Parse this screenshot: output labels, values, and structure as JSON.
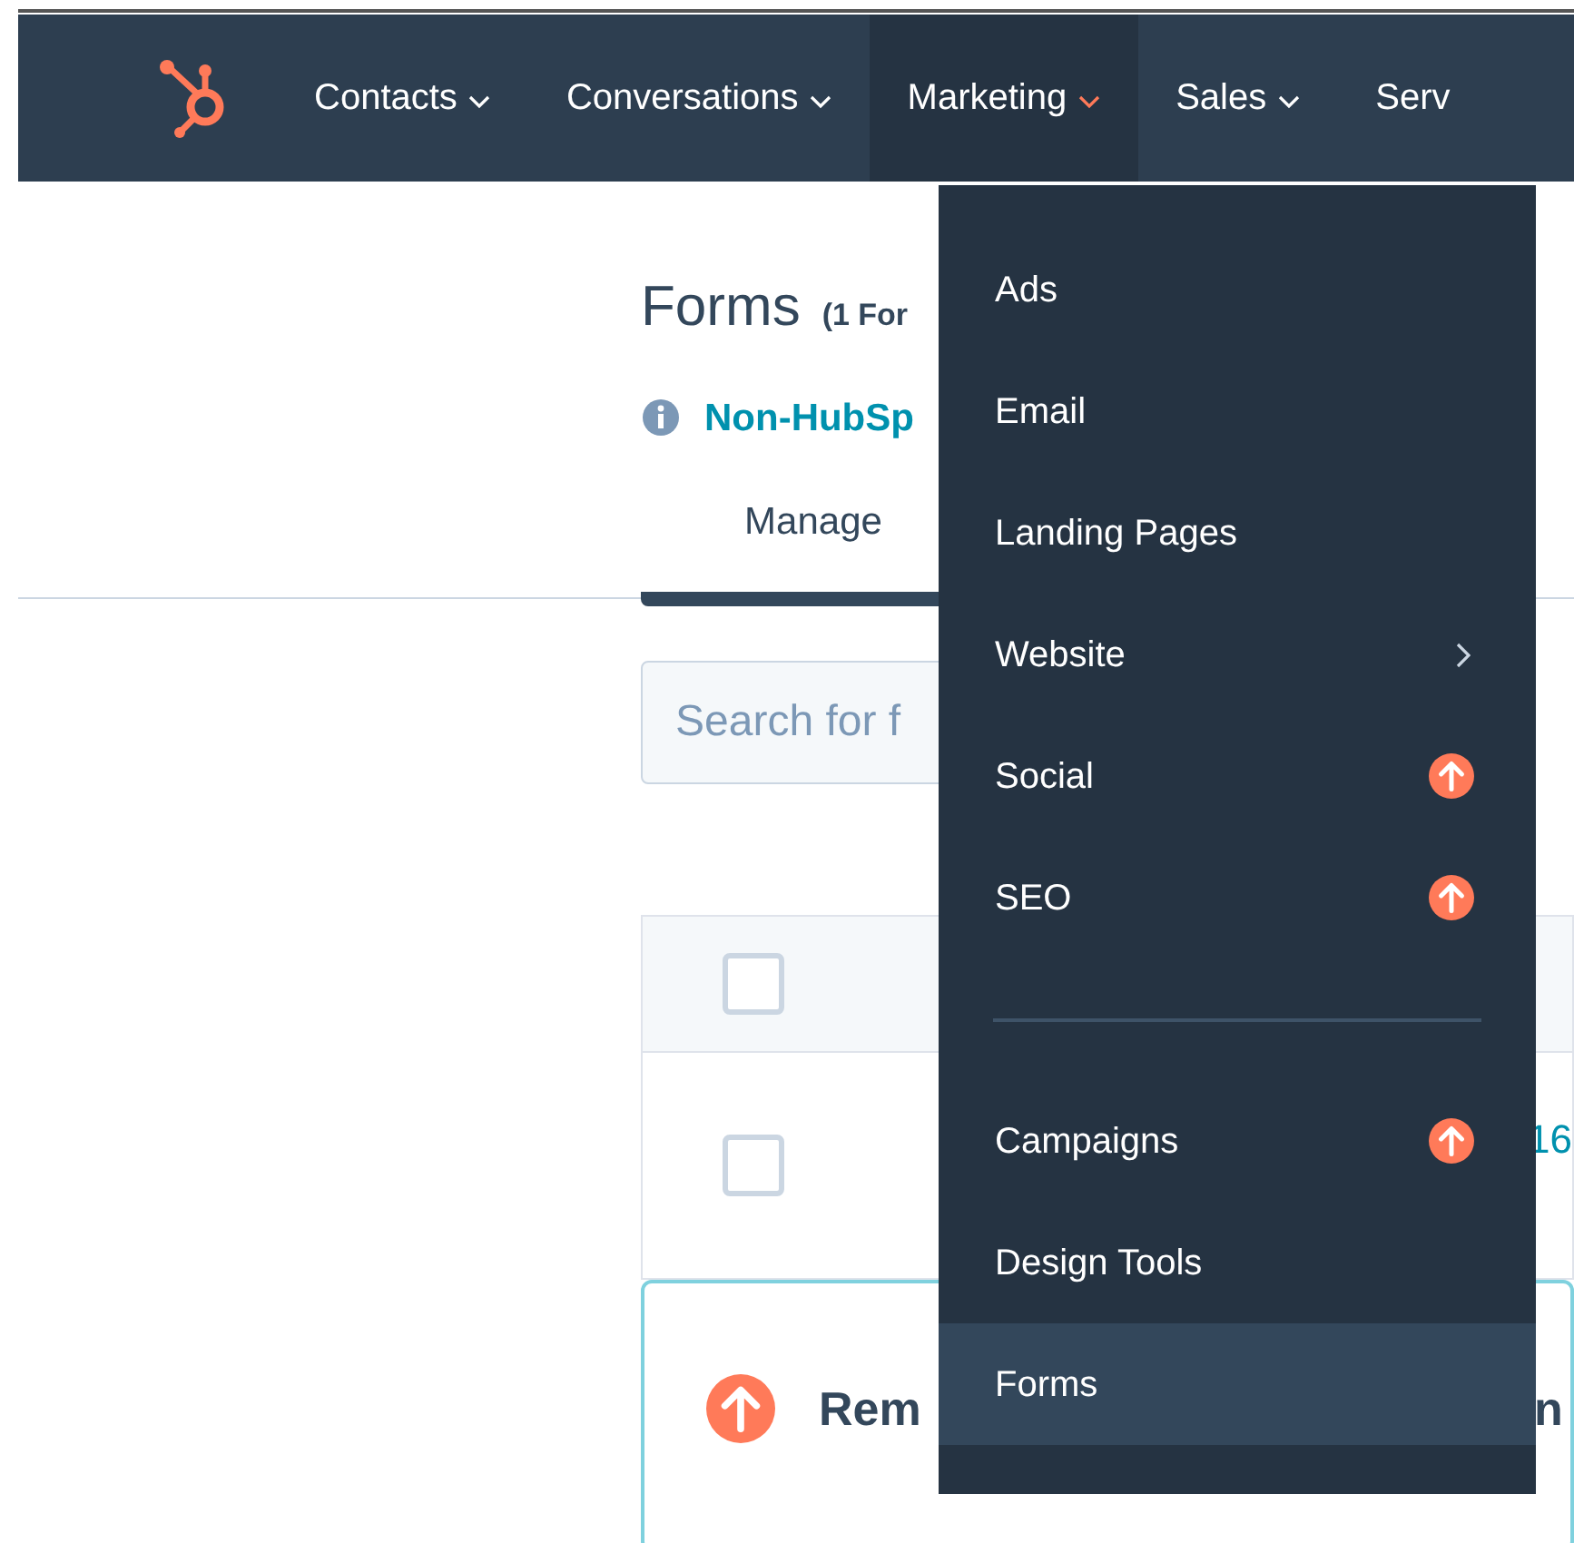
{
  "nav": {
    "items": [
      {
        "label": "Contacts",
        "selected": false,
        "caret": true
      },
      {
        "label": "Conversations",
        "selected": false,
        "caret": true
      },
      {
        "label": "Marketing",
        "selected": true,
        "caret": true
      },
      {
        "label": "Sales",
        "selected": false,
        "caret": true
      },
      {
        "label": "Serv",
        "selected": false,
        "caret": false
      }
    ]
  },
  "page": {
    "title": "Forms",
    "count": "(1 For",
    "info_link": "Non-HubSp",
    "tabs": [
      {
        "label": "Manage",
        "selected": true
      }
    ],
    "search": {
      "placeholder": "Search for f"
    },
    "table": {
      "header_checked": false,
      "rows": [
        {
          "checked": false,
          "cell": "16"
        }
      ]
    },
    "banner": {
      "title": "Rem",
      "title_end": "n"
    }
  },
  "dropdown": {
    "items": [
      {
        "kind": "link",
        "label": "Ads",
        "selected": false
      },
      {
        "kind": "link",
        "label": "Email",
        "selected": false
      },
      {
        "kind": "link",
        "label": "Landing Pages",
        "selected": false
      },
      {
        "kind": "submenu",
        "label": "Website",
        "selected": false
      },
      {
        "kind": "upgrade",
        "label": "Social",
        "selected": false
      },
      {
        "kind": "upgrade",
        "label": "SEO",
        "selected": false
      },
      {
        "kind": "divider"
      },
      {
        "kind": "upgrade",
        "label": "Campaigns",
        "selected": false
      },
      {
        "kind": "link",
        "label": "Design Tools",
        "selected": false
      },
      {
        "kind": "link",
        "label": "Forms",
        "selected": true
      }
    ]
  }
}
